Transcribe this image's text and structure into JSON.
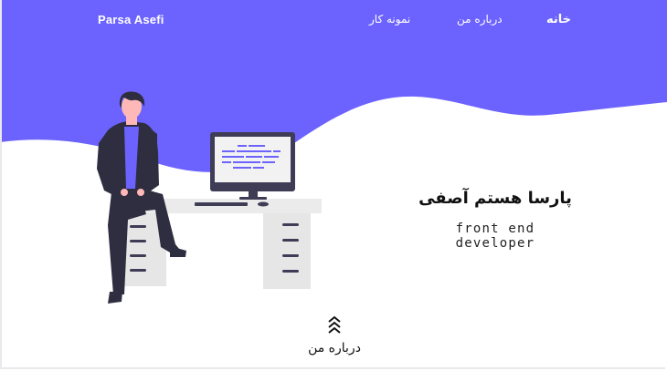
{
  "header": {
    "brand": "Parsa Asefi",
    "nav": {
      "home": "خانه",
      "about": "درباره من",
      "portfolio": "نمونه کار"
    }
  },
  "hero": {
    "name": "پارسا هستم آصفی",
    "role": "front end developer"
  },
  "scroll": {
    "label": "درباره من",
    "icon": "double-chevron-up-icon"
  },
  "colors": {
    "accent": "#6c63ff",
    "background": "#ffffff",
    "text": "#111111",
    "figure_dark": "#2f2e41",
    "desk": "#e6e6e6"
  }
}
